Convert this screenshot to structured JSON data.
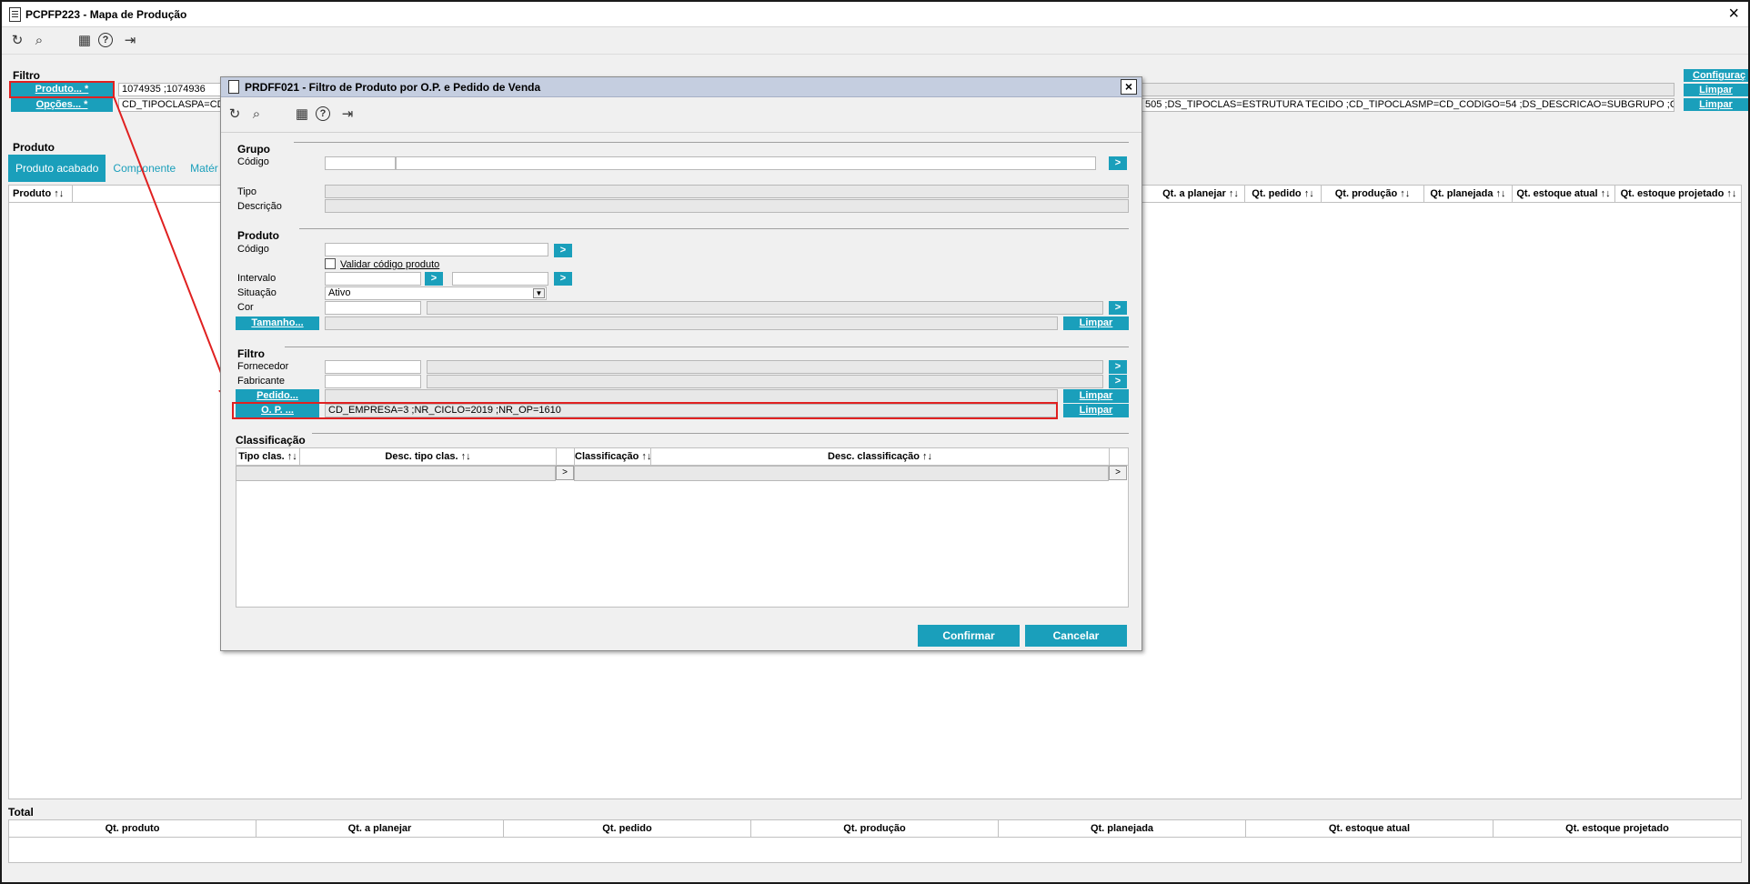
{
  "window": {
    "title": "PCPFP223 - Mapa de Produção"
  },
  "main": {
    "filtro_label": "Filtro",
    "produto_btn": "Produto... *",
    "opcoes_btn": "Opções... *",
    "produto_value": "1074935 ;1074936",
    "opcoes_value": "CD_TIPOCLASPA=CD_",
    "opcoes_value_right": "505 ;DS_TIPOCLAS=ESTRUTURA TECIDO ;CD_TIPOCLASMP=CD_CODIGO=54 ;DS_DESCRICAO=SUBGRUPO ;CD_",
    "configuracao_btn": "Configuraç",
    "limpar_label": "Limpar",
    "produto_section": "Produto",
    "tabs": [
      "Produto acabado",
      "Componente",
      "Matér"
    ],
    "grid_left_header": "Produto ↑↓",
    "grid_headers": [
      "Qt. a planejar ↑↓",
      "Qt. pedido ↑↓",
      "Qt. produção ↑↓",
      "Qt. planejada ↑↓",
      "Qt. estoque atual ↑↓",
      "Qt. estoque projetado ↑↓"
    ],
    "total_label": "Total",
    "total_headers": [
      "Qt. produto",
      "Qt. a planejar",
      "Qt. pedido",
      "Qt. produção",
      "Qt. planejada",
      "Qt. estoque atual",
      "Qt. estoque projetado"
    ]
  },
  "dialog": {
    "title": "PRDFF021 - Filtro de Produto por O.P. e Pedido de Venda",
    "grupo": {
      "section": "Grupo",
      "codigo": "Código",
      "tipo": "Tipo",
      "descricao": "Descrição"
    },
    "produto": {
      "section": "Produto",
      "codigo": "Código",
      "validar": "Validar código produto",
      "intervalo": "Intervalo",
      "situacao": "Situação",
      "situacao_value": "Ativo",
      "cor": "Cor",
      "tamanho_btn": "Tamanho...",
      "limpar": "Limpar"
    },
    "filtro": {
      "section": "Filtro",
      "fornecedor": "Fornecedor",
      "fabricante": "Fabricante",
      "pedido_btn": "Pedido...",
      "op_btn": "O. P. ...",
      "op_value": "CD_EMPRESA=3 ;NR_CICLO=2019 ;NR_OP=1610",
      "limpar": "Limpar"
    },
    "classificacao": {
      "section": "Classificação",
      "left_headers": [
        "Tipo clas. ↑↓",
        "Desc. tipo clas. ↑↓"
      ],
      "right_headers": [
        "Classificação ↑↓",
        "Desc. classificação ↑↓"
      ],
      "more": ">"
    },
    "confirmar": "Confirmar",
    "cancelar": "Cancelar"
  },
  "icons": {
    "refresh": "↻",
    "search": "⌕",
    "calendar": "▦",
    "help": "?",
    "exit": "⇥",
    "arrow": ">",
    "close": "×"
  }
}
